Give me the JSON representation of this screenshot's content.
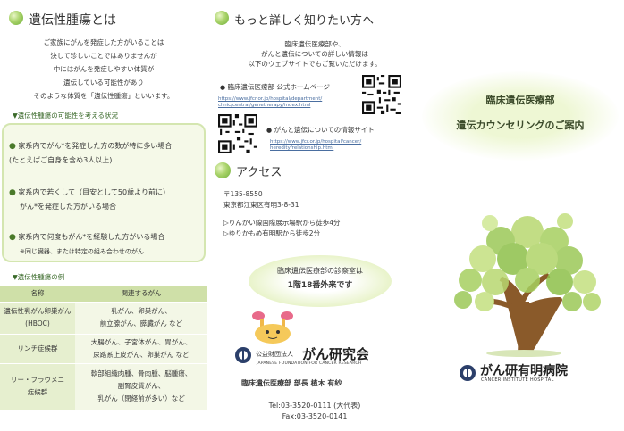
{
  "left": {
    "title": "遺伝性腫瘍とは",
    "intro": [
      "ご家族にがんを発症した方がいることは",
      "決して珍しいことではありませんが",
      "中にはがんを発症しやすい体質が",
      "遺伝している可能性があり",
      "そのような体質を「遺伝性腫瘍」といいます。"
    ],
    "check_heading": "▼遺伝性腫瘍の可能性を考える状況",
    "checks": [
      {
        "l1": "家系内でがん*を発症した方の数が特に多い場合",
        "l2": "(たとえばご自身を含め3人以上)"
      },
      {
        "l1": "家系内で若くして（目安として50歳より前に）",
        "l2": "がん*を発症した方がいる場合"
      },
      {
        "l1": "家系内で何度もがん*を経験した方がいる場合",
        "l2": "※同じ臓器、または特定の組み合わせのがん"
      }
    ],
    "table_heading": "▼遺伝性腫瘍の例",
    "table": {
      "headers": [
        "名称",
        "関連するがん"
      ],
      "rows": [
        {
          "name": [
            "遺伝性乳がん卵巣がん",
            "(HBOC)"
          ],
          "cancers": [
            "乳がん、卵巣がん、",
            "前立腺がん、膵臓がん など"
          ]
        },
        {
          "name": [
            "リンチ症候群"
          ],
          "cancers": [
            "大腸がん、子宮体がん、胃がん、",
            "尿路系上皮がん、卵巣がん など"
          ]
        },
        {
          "name": [
            "リー・フラウメニ",
            "症候群"
          ],
          "cancers": [
            "軟部組織肉腫、骨肉腫、脳腫瘍、",
            "副腎皮質がん、",
            "乳がん（閉経前が多い）など"
          ]
        }
      ]
    }
  },
  "middle": {
    "more_title": "もっと詳しく知りたい方へ",
    "more_text": [
      "臨床遺伝医療部や、",
      "がんと遺伝についての詳しい情報は",
      "以下のウェブサイトでもご覧いただけます。"
    ],
    "site1_label": "臨床遺伝医療部 公式ホームページ",
    "site1_url": [
      "https://www.jfcr.or.jp/hospital/department/",
      "clinic/central/genetherapy/index.html"
    ],
    "site2_label": "がんと遺伝についての情報サイト",
    "site2_url": [
      "https://www.jfcr.or.jp/hospital/cancer/",
      "heredity/relationship.html"
    ],
    "access_title": "アクセス",
    "address": [
      "〒135-8550",
      "東京都江東区有明3-8-31"
    ],
    "routes": [
      "▷りんかい線国際展示場駅から徒歩4分",
      "▷ゆりかもめ有明駅から徒歩2分"
    ],
    "bubble": [
      "臨床遺伝医療部の診察室は",
      "1階18番外来です"
    ],
    "org_prefix": "公益財団法人",
    "org_name": "がん研究会",
    "org_en": "JAPANESE FOUNDATION FOR CANCER RESEARCH",
    "dept_line": "臨床遺伝医療部 部長 植木 有紗",
    "tel": "Tel:03-3520-0111 (大代表)",
    "fax": "Fax:03-3520-0141"
  },
  "right": {
    "title1": "臨床遺伝医療部",
    "title2": "遺伝カウンセリングのご案内",
    "hospital_name": "がん研有明病院",
    "hospital_en": "CANCER INSTITUTE HOSPITAL"
  }
}
